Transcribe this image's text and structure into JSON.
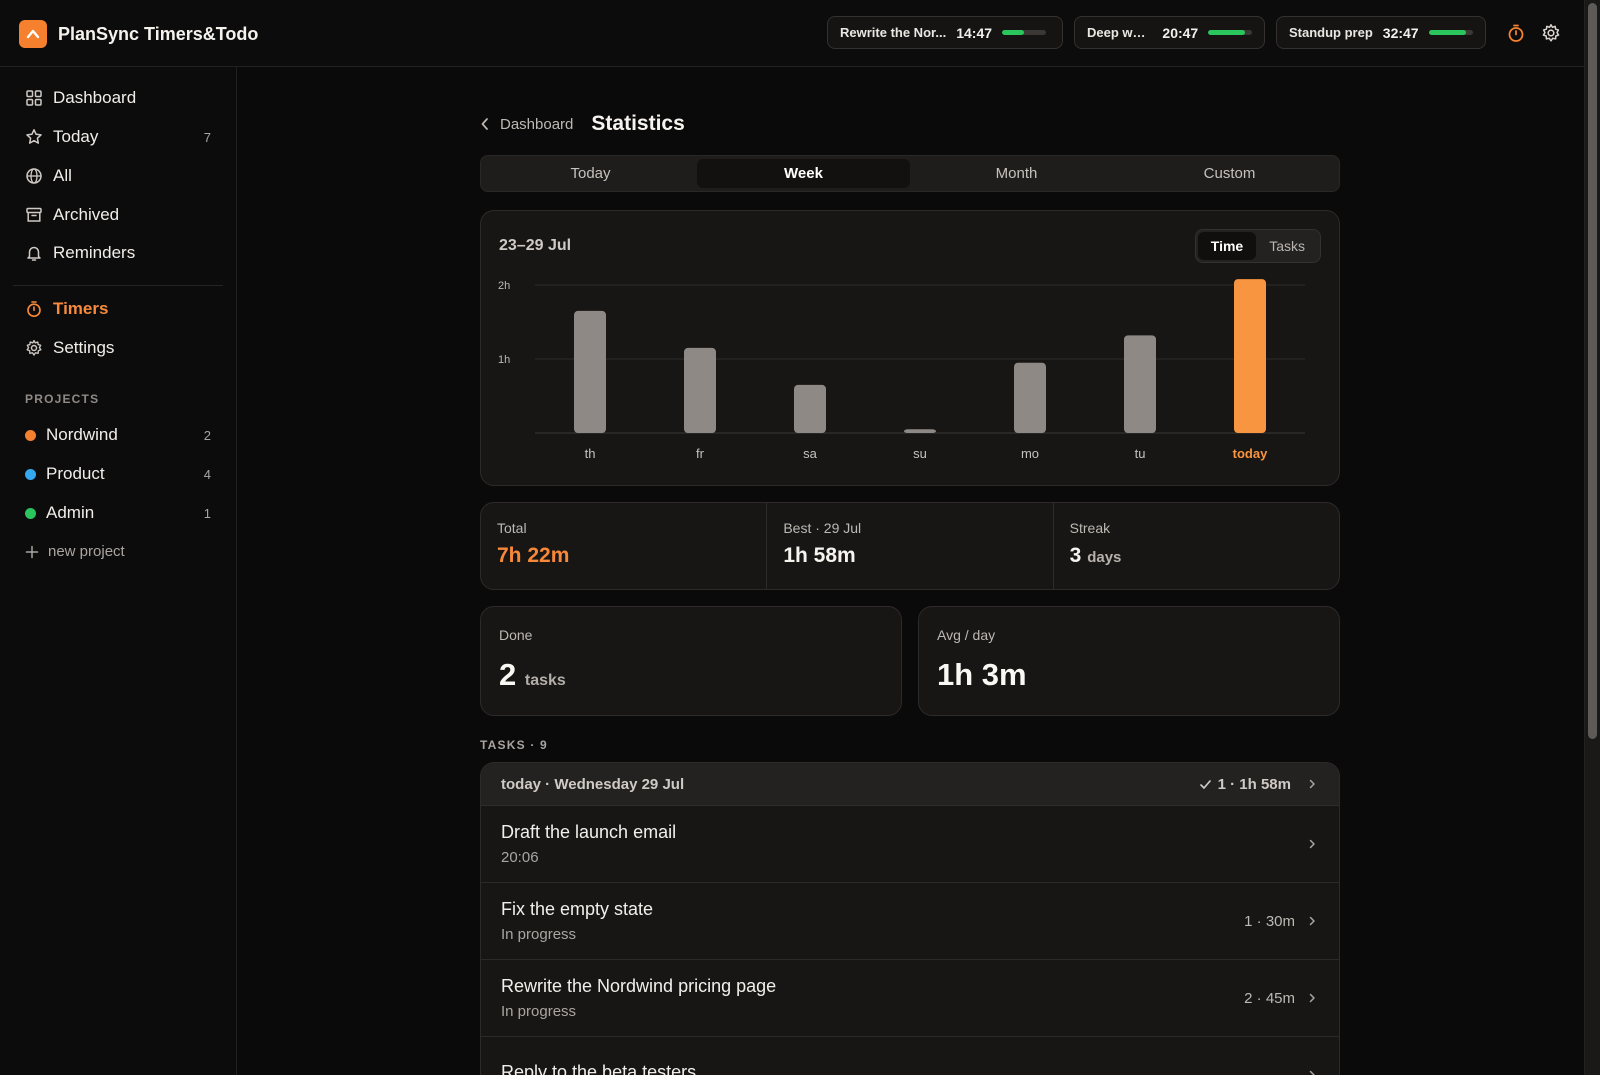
{
  "app": {
    "name": "PlanSync Timers&Todo"
  },
  "timers": [
    {
      "name": "Rewrite the Nor...",
      "time": "14:47",
      "progress": 0.5
    },
    {
      "name": "Deep work",
      "time": "20:47",
      "progress": 0.85
    },
    {
      "name": "Standup prep",
      "time": "32:47",
      "progress": 0.85
    }
  ],
  "sidebar": {
    "nav": [
      {
        "label": "Dashboard",
        "icon": "grid-icon",
        "count": ""
      },
      {
        "label": "Today",
        "icon": "star-icon",
        "count": "7"
      },
      {
        "label": "All",
        "icon": "globe-icon",
        "count": ""
      },
      {
        "label": "Archived",
        "icon": "archive-icon",
        "count": ""
      },
      {
        "label": "Reminders",
        "icon": "bell-icon",
        "count": ""
      }
    ],
    "nav2": [
      {
        "label": "Timers",
        "icon": "timer-icon",
        "active": true
      },
      {
        "label": "Settings",
        "icon": "gear-icon"
      }
    ],
    "projects_title": "PROJECTS",
    "projects": [
      {
        "label": "Nordwind",
        "count": "2",
        "color": "#f5812f"
      },
      {
        "label": "Product",
        "count": "4",
        "color": "#35a9ef"
      },
      {
        "label": "Admin",
        "count": "1",
        "color": "#2bc55e"
      }
    ],
    "new_project": "new project"
  },
  "header": {
    "back_label": "Dashboard",
    "title": "Statistics"
  },
  "range_tabs": [
    {
      "label": "Today",
      "active": false
    },
    {
      "label": "Week",
      "active": true
    },
    {
      "label": "Month",
      "active": false
    },
    {
      "label": "Custom",
      "active": false
    }
  ],
  "chart": {
    "range_label": "23–29 Jul",
    "toggle": [
      {
        "label": "Time",
        "active": true
      },
      {
        "label": "Tasks",
        "active": false
      }
    ]
  },
  "chart_data": {
    "type": "bar",
    "categories": [
      "th",
      "fr",
      "sa",
      "su",
      "mo",
      "tu",
      "today"
    ],
    "values": [
      1.65,
      1.15,
      0.65,
      0.05,
      0.95,
      1.32,
      2.08
    ],
    "unit": "hours",
    "y_ticks": [
      "1h",
      "2h"
    ],
    "ylim": [
      0,
      2.0
    ],
    "highlight_index": 6,
    "colors": {
      "bar": "#8f8985",
      "highlight": "#f79540",
      "grid": "#2e2b2a"
    }
  },
  "stats": {
    "total": {
      "label": "Total",
      "value": "7h 22m"
    },
    "best": {
      "label": "Best · 29 Jul",
      "value": "1h 58m"
    },
    "streak": {
      "label": "Streak",
      "value": "3",
      "unit": "days"
    },
    "done": {
      "label": "Done",
      "value": "2",
      "unit": "tasks"
    },
    "avg": {
      "label": "Avg / day",
      "value": "1h 3m"
    }
  },
  "tasks": {
    "title": "TASKS · 9",
    "group": {
      "title": "today · Wednesday 29 Jul",
      "meta": "1 · 1h 58m"
    },
    "items": [
      {
        "title": "Draft the launch email",
        "sub": "20:06",
        "meta": ""
      },
      {
        "title": "Fix the empty state",
        "sub": "In progress",
        "meta": "1 · 30m"
      },
      {
        "title": "Rewrite the Nordwind pricing page",
        "sub": "In progress",
        "meta": "2 · 45m"
      },
      {
        "title": "Reply to the beta testers",
        "sub": "",
        "meta": ""
      }
    ]
  }
}
